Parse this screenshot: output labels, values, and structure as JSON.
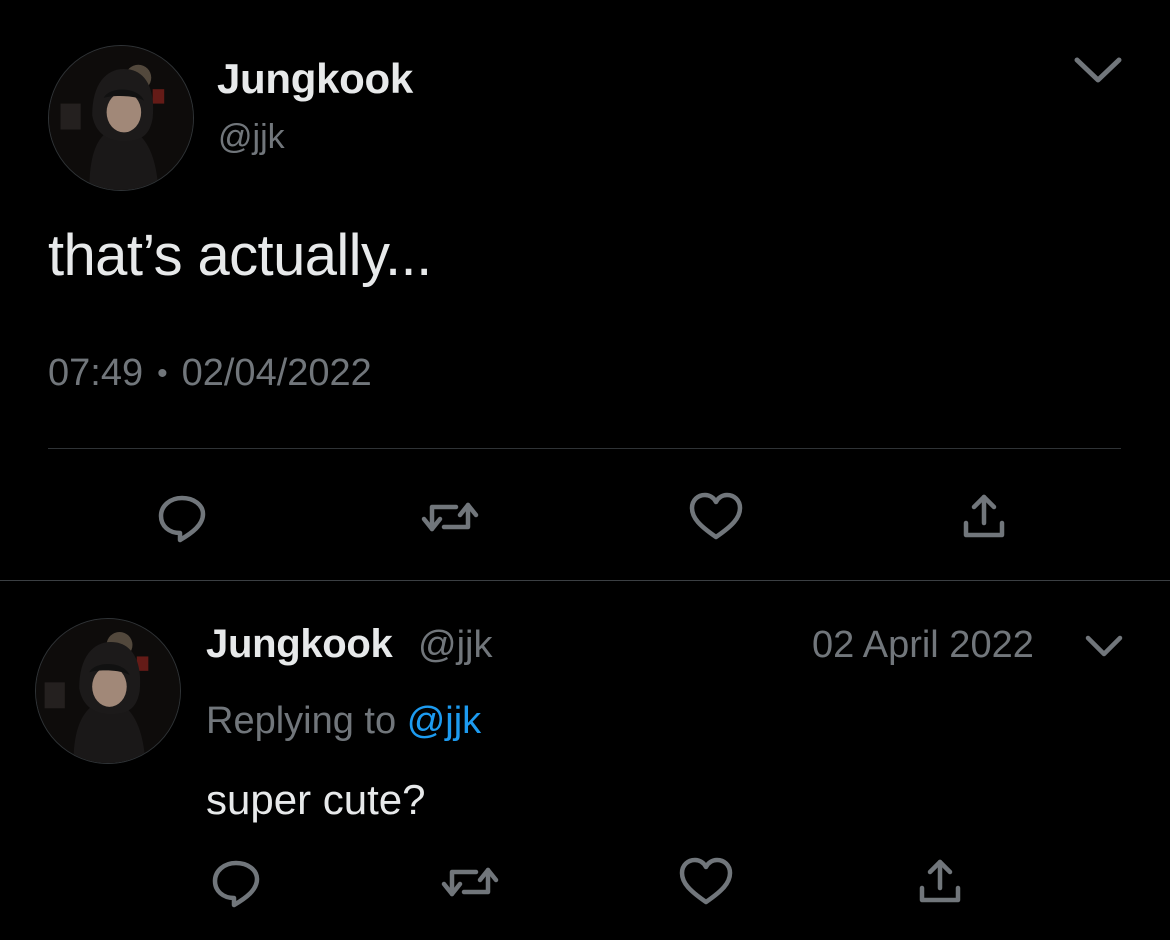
{
  "main_tweet": {
    "display_name": "Jungkook",
    "handle": "@jjk",
    "text": "that’s actually...",
    "time": "07:49",
    "separator": "•",
    "date": "02/04/2022",
    "icons": [
      "reply-icon",
      "retweet-icon",
      "like-icon",
      "share-icon"
    ]
  },
  "reply_tweet": {
    "display_name": "Jungkook",
    "handle": "@jjk",
    "date": "02 April 2022",
    "replying_to_label": "Replying to",
    "replying_to_handle": "@jjk",
    "text": "super cute?",
    "icons": [
      "reply-icon",
      "retweet-icon",
      "like-icon",
      "share-icon"
    ]
  },
  "colors": {
    "background": "#000000",
    "primary_text": "#e7e9ea",
    "secondary_text": "#71767b",
    "mention": "#1d9bf0",
    "divider": "#2f3336"
  }
}
